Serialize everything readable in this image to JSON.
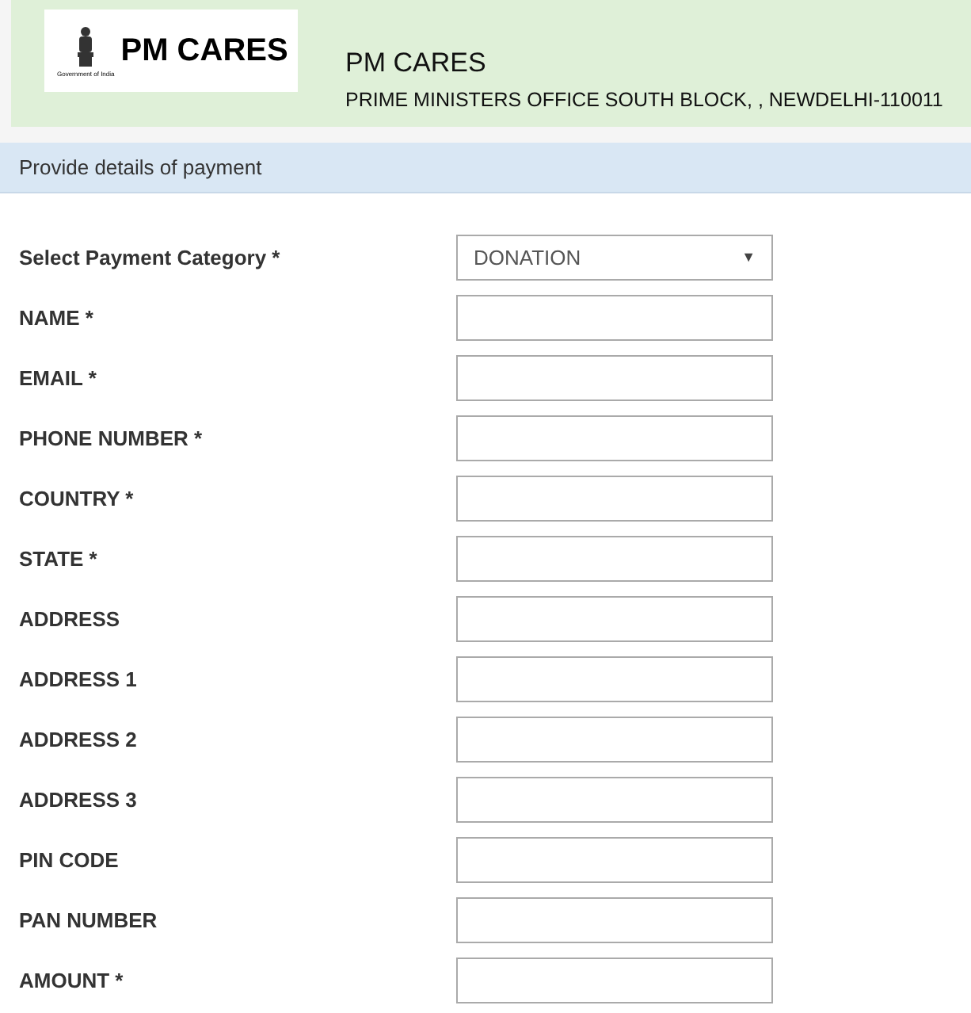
{
  "header": {
    "logo_text": "PM CARES",
    "logo_caption": "Government of India",
    "title": "PM CARES",
    "address": "PRIME MINISTERS OFFICE SOUTH BLOCK, , NEWDELHI-110011"
  },
  "section_title": "Provide details of payment",
  "fields": [
    {
      "label": "Select Payment Category *",
      "kind": "select",
      "value": "DONATION",
      "caret": "▼"
    },
    {
      "label": "NAME *",
      "kind": "text"
    },
    {
      "label": "EMAIL *",
      "kind": "text"
    },
    {
      "label": "PHONE NUMBER *",
      "kind": "text"
    },
    {
      "label": "COUNTRY *",
      "kind": "text"
    },
    {
      "label": "STATE *",
      "kind": "text"
    },
    {
      "label": "ADDRESS",
      "kind": "text"
    },
    {
      "label": "ADDRESS 1",
      "kind": "text"
    },
    {
      "label": "ADDRESS 2",
      "kind": "text"
    },
    {
      "label": "ADDRESS 3",
      "kind": "text"
    },
    {
      "label": "PIN CODE",
      "kind": "text"
    },
    {
      "label": "PAN NUMBER",
      "kind": "text"
    },
    {
      "label": "AMOUNT *",
      "kind": "text"
    }
  ]
}
